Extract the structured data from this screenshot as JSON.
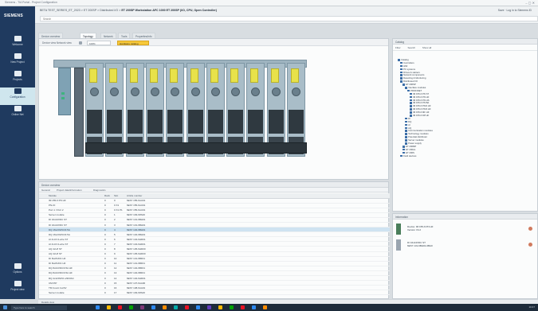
{
  "window": {
    "title": "Siemens - TIA Portal - Project Configuration"
  },
  "brand": "SIEMENS",
  "header": {
    "breadcrumb_prefix": "BETA TEST_SERIES_ET_2023 > ET 200SP > Distributed I/O > ",
    "breadcrumb_current": "ET 200SP Workstation AFC 1000 ET 200SP (I/O, CPU, Open Controller)",
    "right_actions": "Save  ·  Log in to Siemens ID",
    "search_placeholder": "Search"
  },
  "leftnav": {
    "items": [
      {
        "label": "Welcome"
      },
      {
        "label": "New Project"
      },
      {
        "label": "Projects"
      },
      {
        "label": "Configuration"
      },
      {
        "label": "Online Net"
      },
      {
        "label": "Options"
      },
      {
        "label": "Project view"
      }
    ]
  },
  "tabs": [
    "Device overview",
    "Topology",
    "Network",
    "Tools",
    "Properties/info"
  ],
  "editor": {
    "toolbar_label": "Device view  Network view",
    "zoom": "100%",
    "hw_button": "Hardware catalog"
  },
  "details": {
    "header": "Device overview",
    "subtabs": [
      "General",
      "Project data/information",
      "Diagnostics"
    ],
    "columns": [
      "",
      "Module",
      "Rack",
      "Slot",
      "Article number"
    ],
    "rows": [
      {
        "icon": "",
        "module": "IM 155-6 PN HF",
        "rack": "0",
        "slot": "0",
        "article": "6ES7 155-6AU01"
      },
      {
        "icon": "",
        "module": "PN-IO",
        "rack": "0",
        "slot": "0 X1",
        "article": "6ES7 155-6AU01"
      },
      {
        "icon": "",
        "module": "Port 1 / Port 2",
        "rack": "0",
        "slot": "0 X1 P1",
        "article": "6ES7 155-6AU01"
      },
      {
        "icon": "",
        "module": "Server module",
        "rack": "0",
        "slot": "1",
        "article": "6ES7 193-6PA00"
      },
      {
        "icon": "",
        "module": "DI 16x24VDC ST",
        "rack": "0",
        "slot": "2",
        "article": "6ES7 131-6BH01"
      },
      {
        "icon": "",
        "module": "DI 16x24VDC ST",
        "rack": "0",
        "slot": "3",
        "article": "6ES7 131-6BH01"
      },
      {
        "icon": "",
        "module": "DQ 16x24VDC/0.5A",
        "rack": "0",
        "slot": "4",
        "article": "6ES7 132-6BH01"
      },
      {
        "icon": "",
        "module": "DQ 16x24VDC/0.5A",
        "rack": "0",
        "slot": "5",
        "article": "6ES7 132-6BH01"
      },
      {
        "icon": "",
        "module": "AI 4xU/I 2-wire ST",
        "rack": "0",
        "slot": "6",
        "article": "6ES7 134-6HD01"
      },
      {
        "icon": "",
        "module": "AI 4xU/I 2-wire ST",
        "rack": "0",
        "slot": "7",
        "article": "6ES7 134-6HD01"
      },
      {
        "icon": "",
        "module": "AQ 4xU/I ST",
        "rack": "0",
        "slot": "8",
        "article": "6ES7 135-6HD00"
      },
      {
        "icon": "",
        "module": "AQ 4xU/I ST",
        "rack": "0",
        "slot": "9",
        "article": "6ES7 135-6HD00"
      },
      {
        "icon": "",
        "module": "DI 8x24VDC HF",
        "rack": "0",
        "slot": "10",
        "article": "6ES7 131-6BF01"
      },
      {
        "icon": "",
        "module": "DI 8x24VDC HF",
        "rack": "0",
        "slot": "11",
        "article": "6ES7 131-6BF01"
      },
      {
        "icon": "",
        "module": "DQ 8x24VDC/0.5A HF",
        "rack": "0",
        "slot": "12",
        "article": "6ES7 132-6BF01"
      },
      {
        "icon": "",
        "module": "DQ 8x24VDC/0.5A HF",
        "rack": "0",
        "slot": "13",
        "article": "6ES7 132-6BF01"
      },
      {
        "icon": "",
        "module": "RQ 4x120VDC-230VAC",
        "rack": "0",
        "slot": "14",
        "article": "6ES7 132-6HD01"
      },
      {
        "icon": "",
        "module": "CM PtP",
        "rack": "0",
        "slot": "15",
        "article": "6ES7 137-6AA00"
      },
      {
        "icon": "",
        "module": "TM Count 1x24V",
        "rack": "0",
        "slot": "16",
        "article": "6ES7 138-6AA01"
      },
      {
        "icon": "",
        "module": "Server module",
        "rack": "0",
        "slot": "17",
        "article": "6ES7 193-6PA00"
      }
    ],
    "selected_index": 6
  },
  "catalog": {
    "header": "Catalog",
    "tools": [
      "Filter",
      "Search",
      "Show all"
    ],
    "tree": [
      "Catalog",
      "Controllers",
      "HMI",
      "PC systems",
      "Drives & starters",
      "Network components",
      "Detecting & Monitoring",
      "Distributed I/O",
      "ET 200SP",
      "Interface modules",
      "PROFINET",
      "IM 155-6 PN ST",
      "IM 155-6 PN HF",
      "IM 155-6 PN HS",
      "IM 155-6 PN BA",
      "IM 155-6 PN/2 HF",
      "IM 155-6 PN/3 HF",
      "IM 155-6 MF HF",
      "IM 155-6 DP HF",
      "DI",
      "DQ",
      "AI",
      "AQ",
      "Communication modules",
      "Technology modules",
      "Potential distributor",
      "Server modules",
      "Power supply",
      "ET 200MP",
      "ET 200AL",
      "ET 200S",
      "Field devices"
    ]
  },
  "info": {
    "header": "Information",
    "items": [
      {
        "title": "Device: IM 155-6 PN HF",
        "sub": "Version V4.2"
      },
      {
        "title": "DI 16x24VDC ST",
        "sub": "6ES7 131-6BH01-0BA0"
      }
    ]
  },
  "statusbar": "Details view",
  "taskbar": {
    "search_placeholder": "Type here to search",
    "clock": "10:47"
  }
}
